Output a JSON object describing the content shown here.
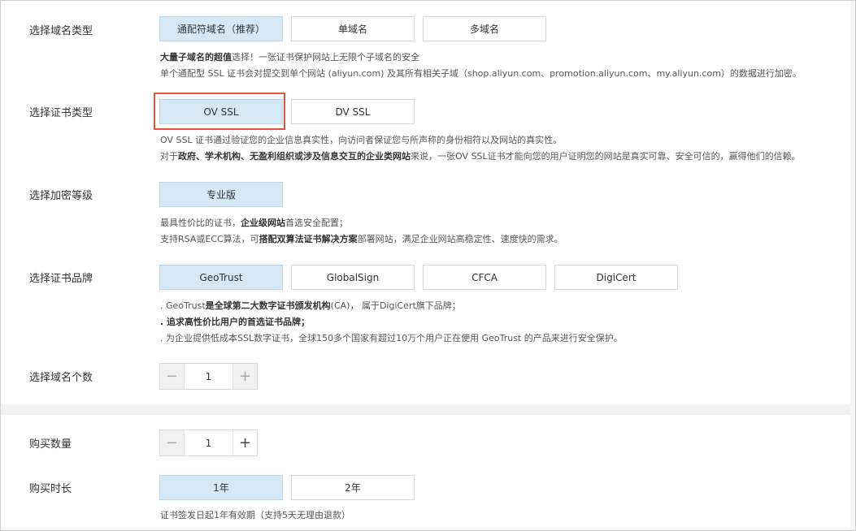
{
  "domain_type": {
    "label": "选择域名类型",
    "options": [
      "通配符域名（推荐）",
      "单域名",
      "多域名"
    ],
    "desc_line1_bold": "大量子域名的超值",
    "desc_line1_rest": "选择！一张证书保护网站上无限个子域名的安全",
    "desc_line2": "单个通配型 SSL 证书会对提交到单个网站 (aliyun.com) 及其所有相关子域（shop.aliyun.com、promotion.aliyun.com、my.aliyun.com）的数据进行加密。"
  },
  "cert_type": {
    "label": "选择证书类型",
    "options": [
      "OV SSL",
      "DV SSL"
    ],
    "desc_line1": "OV SSL 证书通过验证您的企业信息真实性，向访问者保证您与所声称的身份相符以及网站的真实性。",
    "desc_line2_pre": "对于",
    "desc_line2_bold": "政府、学术机构、无盈利组织或涉及信息交互的企业类网站",
    "desc_line2_rest": "来说，一张OV SSL证书才能向您的用户证明您的网站是真实可靠、安全可信的，赢得他们的信赖。"
  },
  "encryption": {
    "label": "选择加密等级",
    "options": [
      "专业版"
    ],
    "desc_line1_pre": "最具性价比的证书，",
    "desc_line1_bold": "企业级网站",
    "desc_line1_rest": "首选安全配置；",
    "desc_line2_pre": "支持RSA或ECC算法，可",
    "desc_line2_bold": "搭配双算法证书解决方案",
    "desc_line2_rest": "部署网站，满足企业网站高稳定性、速度快的需求。"
  },
  "brand": {
    "label": "选择证书品牌",
    "options": [
      "GeoTrust",
      "GlobalSign",
      "CFCA",
      "DigiCert"
    ],
    "desc_line1_pre": ". GeoTrust",
    "desc_line1_bold": "是全球第二大数字证书颁发机构",
    "desc_line1_rest": "(CA)， 属于DigiCert旗下品牌；",
    "desc_line2_bold": ". 追求高性价比用户的首选证书品牌；",
    "desc_line3": ". 为企业提供低成本SSL数字证书，全球150多个国家有超过10万个用户正在使用 GeoTrust 的产品来进行安全保护。"
  },
  "domain_count": {
    "label": "选择域名个数",
    "value": "1",
    "minus": "−",
    "plus": "+"
  },
  "quantity": {
    "label": "购买数量",
    "value": "1",
    "minus": "−",
    "plus": "+"
  },
  "duration": {
    "label": "购买时长",
    "options": [
      "1年",
      "2年"
    ],
    "desc": "证书签发日起1年有效期（支持5天无理由退款）"
  },
  "colors": {
    "selected_bg": "#d4e8f7",
    "highlight_border": "#e5533c"
  }
}
